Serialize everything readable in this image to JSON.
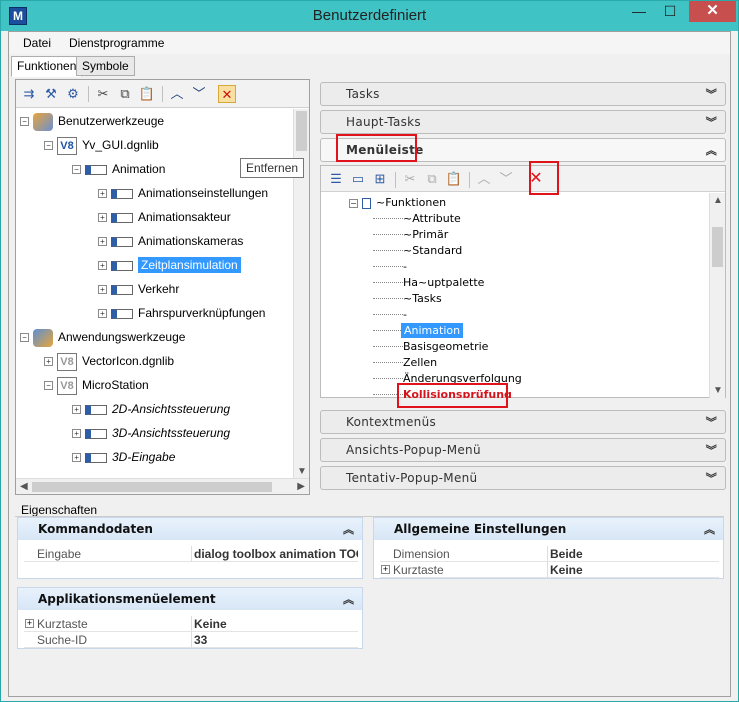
{
  "window": {
    "title": "Benutzerdefiniert",
    "minimize": "—",
    "maximize": "☐",
    "close": "✕"
  },
  "menubar": {
    "items": [
      "Datei",
      "Dienstprogramme"
    ]
  },
  "tabs": [
    {
      "label": "Funktionen"
    },
    {
      "label": "Symbole"
    }
  ],
  "tooltip": "Entfernen",
  "left_tree": {
    "rows": [
      {
        "label": "Benutzerwerkzeuge"
      },
      {
        "label": "Yv_GUI.dgnlib"
      },
      {
        "label": "Animation"
      },
      {
        "label": "Animationseinstellungen"
      },
      {
        "label": "Animationsakteur"
      },
      {
        "label": "Animationskameras"
      },
      {
        "label": "Zeitplansimulation"
      },
      {
        "label": "Verkehr"
      },
      {
        "label": "Fahrspurverknüpfungen"
      },
      {
        "label": "Anwendungswerkzeuge"
      },
      {
        "label": "VectorIcon.dgnlib"
      },
      {
        "label": "MicroStation"
      },
      {
        "label": "2D-Ansichtssteuerung"
      },
      {
        "label": "3D-Ansichtssteuerung"
      },
      {
        "label": "3D-Eingabe"
      }
    ]
  },
  "accordion": {
    "tasks": "Tasks",
    "haupt_tasks": "Haupt-Tasks",
    "menueleiste": "Menüleiste",
    "kontextmenues": "Kontextmenüs",
    "ansichts_popup": "Ansichts-Popup-Menü",
    "tentativ_popup": "Tentativ-Popup-Menü"
  },
  "menu_tree": {
    "root": "~Funktionen",
    "items": [
      "~Attribute",
      "~Primär",
      "~Standard",
      "-",
      "Ha~uptpalette",
      "~Tasks",
      "-",
      "Animation",
      "Basisgeometrie",
      "Zellen",
      "Änderungsverfolgung",
      "Kollisionsprüfung"
    ]
  },
  "properties": {
    "label": "Eigenschaften",
    "kommandodaten": {
      "title": "Kommandodaten",
      "rows": [
        {
          "key": "Eingabe",
          "value": "dialog toolbox animation TOGGLE"
        }
      ]
    },
    "allgemeine": {
      "title": "Allgemeine Einstellungen",
      "rows": [
        {
          "key": "Dimension",
          "value": "Beide"
        },
        {
          "key": "Kurztaste",
          "value": "Keine"
        }
      ]
    },
    "applikation": {
      "title": "Applikationsmenüelement",
      "rows": [
        {
          "key": "Kurztaste",
          "value": "Keine"
        },
        {
          "key": "Suche-ID",
          "value": "33"
        }
      ]
    }
  },
  "colors": {
    "accent": "#40c3c5",
    "selection": "#3399ff",
    "highlight_red": "#e0121a"
  }
}
